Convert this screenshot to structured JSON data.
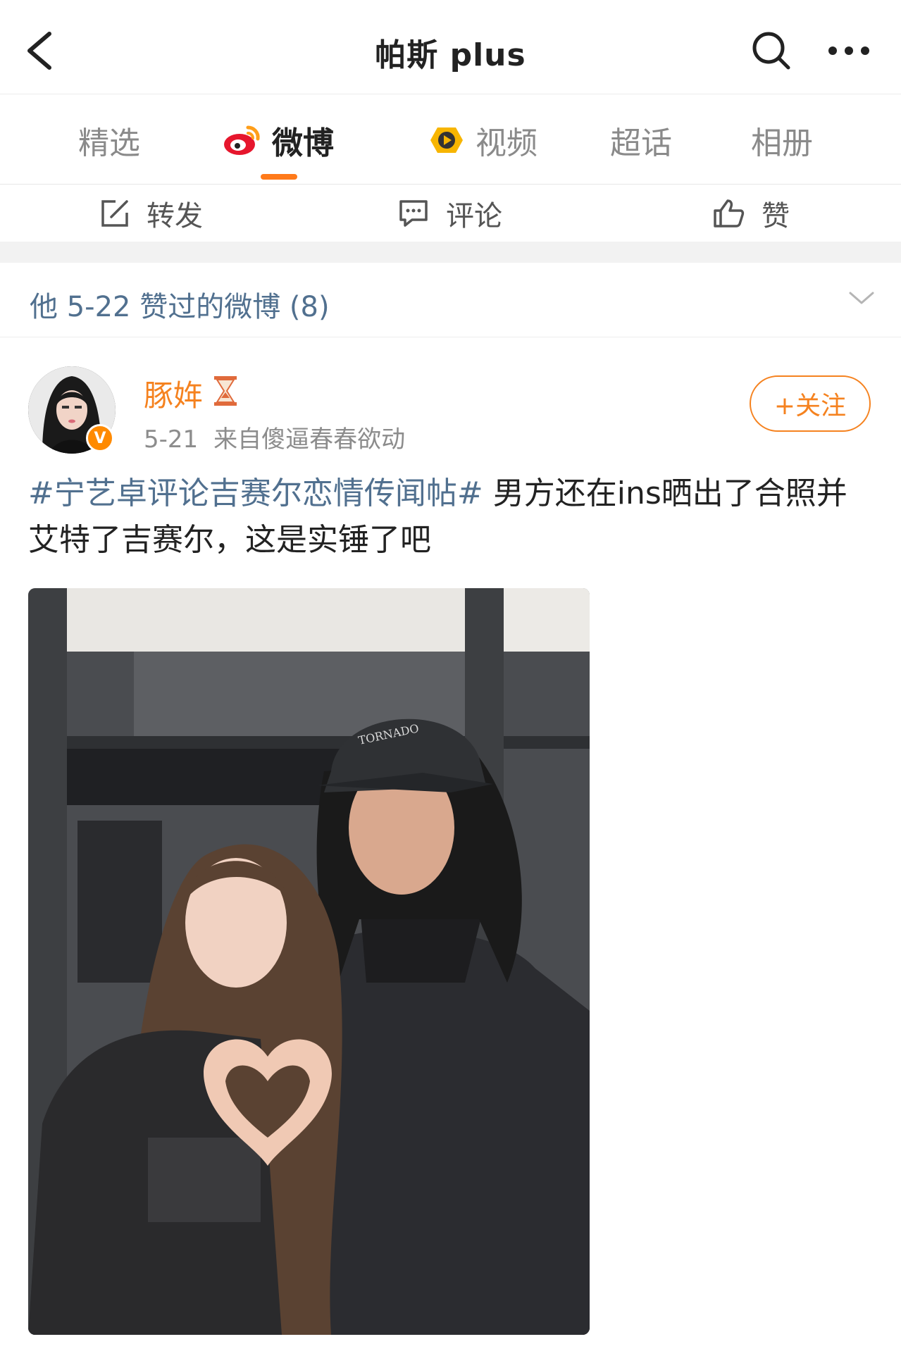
{
  "header": {
    "title": "帕斯 plus"
  },
  "tabs": [
    {
      "label": "精选",
      "active": false
    },
    {
      "label": "微博",
      "active": true,
      "icon": "weibo-logo-icon"
    },
    {
      "label": "视频",
      "active": false,
      "icon": "video-play-icon"
    },
    {
      "label": "超话",
      "active": false
    },
    {
      "label": "相册",
      "active": false
    }
  ],
  "actions": {
    "repost": "转发",
    "comment": "评论",
    "like": "赞"
  },
  "liked_section": {
    "text": "他 5-22 赞过的微博 (8)"
  },
  "post": {
    "username": "豚姩",
    "date": "5-21",
    "source": "来自傻逼春春欲动",
    "follow_label": "+关注",
    "hashtag": "#宁艺卓评论吉赛尔恋情传闻帖#",
    "body": " 男方还在ins晒出了合照并艾特了吉赛尔，这是实锤了吧",
    "verified_badge": "V",
    "photo_cap_text": "TORNADO"
  },
  "colors": {
    "accent": "#f5821f",
    "link": "#51708f",
    "tab_indicator": "#ff7a1a"
  }
}
